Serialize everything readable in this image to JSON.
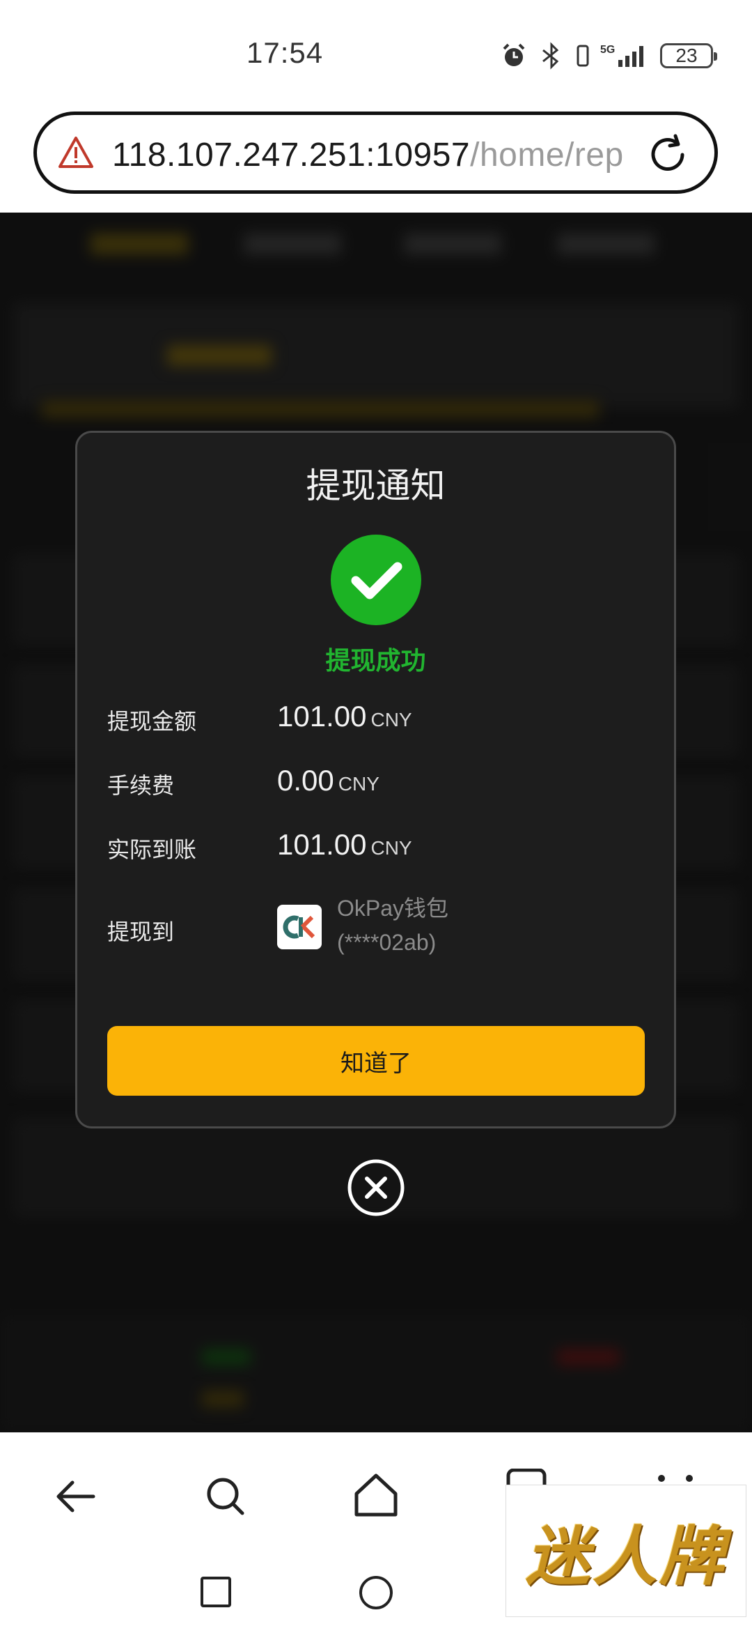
{
  "status_bar": {
    "time": "17:54",
    "battery": "23",
    "network": "5G"
  },
  "url_bar": {
    "host": "118.107.247.251:10957",
    "path": "/home/rep"
  },
  "dialog": {
    "title": "提现通知",
    "status": "提现成功",
    "rows": [
      {
        "label": "提现金额",
        "amount": "101.00",
        "unit": "CNY"
      },
      {
        "label": "手续费",
        "amount": "0.00",
        "unit": "CNY"
      },
      {
        "label": "实际到账",
        "amount": "101.00",
        "unit": "CNY"
      }
    ],
    "destination": {
      "label": "提现到",
      "wallet_name": "OkPay钱包",
      "account": "(****02ab)"
    },
    "confirm_label": "知道了"
  },
  "watermark": "迷人牌",
  "colors": {
    "accent": "#fbb307",
    "success": "#1cb324",
    "dialog_bg": "#1d1d1d"
  }
}
